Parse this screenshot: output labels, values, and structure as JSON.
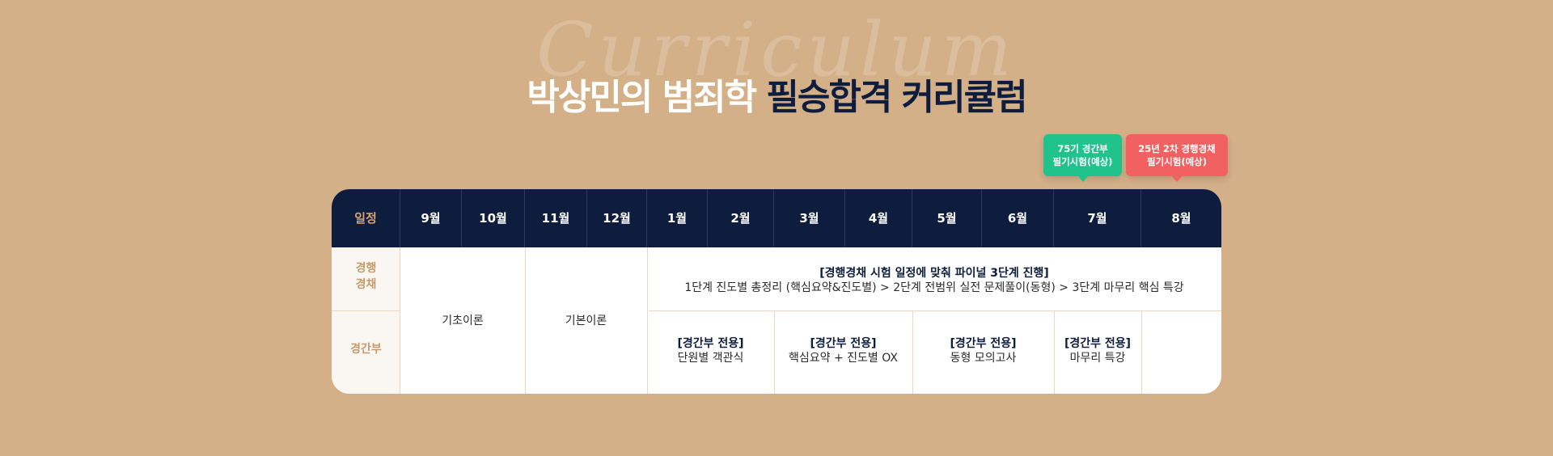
{
  "watermark": "Curriculum",
  "title": {
    "part1": "박상민의 범죄학 ",
    "part2": "필승합격 커리큘럼"
  },
  "badges": [
    {
      "line1": "75기 경간부",
      "line2": "필기시험(예상)",
      "color": "#20c38b"
    },
    {
      "line1": "25년 2차 경행경채",
      "line2": "필기시험(예상)",
      "color": "#f26161"
    }
  ],
  "header": {
    "label": "일정",
    "months": [
      "9월",
      "10월",
      "11월",
      "12월",
      "1월",
      "2월",
      "3월",
      "4월",
      "5월",
      "6월",
      "7월",
      "8월"
    ]
  },
  "rows": {
    "row1_line1": "경행",
    "row1_line2": "경채",
    "row2": "경간부"
  },
  "cells": {
    "basic_theory": "기초이론",
    "core_theory": "기본이론",
    "final_title": "[경행경채 시험 일정에 맞춰 파이널 3단계 진행]",
    "final_desc": "1단계 진도별 총정리 (핵심요약&진도별) > 2단계 전범위 실전 문제풀이(동형) > 3단계 마무리 핵심 특강",
    "gk": [
      {
        "tag": "[경간부 전용]",
        "desc": "단원별 객관식"
      },
      {
        "tag": "[경간부 전용]",
        "desc": "핵심요약 + 진도별 OX"
      },
      {
        "tag": "[경간부 전용]",
        "desc": "동형 모의고사"
      },
      {
        "tag": "[경간부 전용]",
        "desc": "마무리 특강"
      }
    ]
  },
  "colors": {
    "background": "#d4b089",
    "navy": "#0e1d3d",
    "accent": "#d4a373",
    "green": "#20c38b",
    "red": "#f26161"
  }
}
